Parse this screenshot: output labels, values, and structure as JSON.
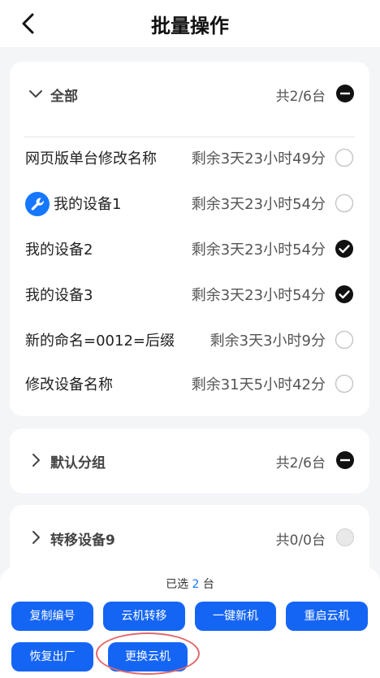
{
  "header": {
    "title": "批量操作",
    "back_icon": "chevron-left-icon"
  },
  "groups": [
    {
      "name": "全部",
      "count": "共2/6台",
      "expanded": true,
      "devices": [
        {
          "name": "网页版单台修改名称",
          "remaining": "剩余3天23小时49分",
          "checked": false
        },
        {
          "name": "我的设备1",
          "remaining": "剩余3天23小时54分",
          "checked": false,
          "icon": "wrench-icon"
        },
        {
          "name": "我的设备2",
          "remaining": "剩余3天23小时54分",
          "checked": true
        },
        {
          "name": "我的设备3",
          "remaining": "剩余3天23小时54分",
          "checked": true
        },
        {
          "name": "新的命名=0012=后缀",
          "remaining": "剩余3天3小时9分",
          "checked": false
        },
        {
          "name": "修改设备名称",
          "remaining": "剩余31天5小时42分",
          "checked": false
        }
      ]
    },
    {
      "name": "默认分组",
      "count": "共2/6台",
      "expanded": false
    },
    {
      "name": "转移设备9",
      "count": "共0/0台",
      "expanded": false
    }
  ],
  "footer": {
    "selected_prefix": "已选",
    "selected_count": "2",
    "selected_suffix": "台",
    "buttons": [
      "复制编号",
      "云机转移",
      "一键新机",
      "重启云机",
      "恢复出厂",
      "更换云机"
    ]
  },
  "colors": {
    "accent": "#1565f5",
    "highlight_ring": "#e06a6a"
  }
}
